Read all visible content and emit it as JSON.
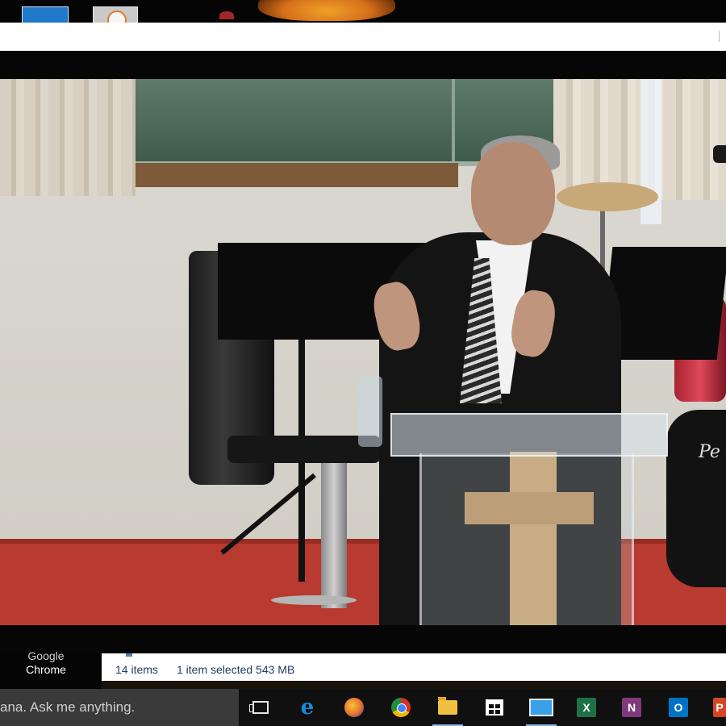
{
  "desktop": {
    "icons": [
      {
        "name": "desktop-shortcut"
      },
      {
        "name": "desktop-shortcut-dial"
      }
    ],
    "chrome_shortcut_label_line1": "Google",
    "chrome_shortcut_label_line2": "Chrome"
  },
  "video": {
    "podium_brand": "Pe"
  },
  "explorer": {
    "status_items": "14 items",
    "status_selected": "1 item selected  543 MB"
  },
  "taskbar": {
    "search_placeholder": "ana. Ask me anything.",
    "apps": [
      {
        "name": "task-view",
        "icon": "task-view-icon"
      },
      {
        "name": "edge",
        "icon": "edge-icon",
        "color": "#1a8ad8"
      },
      {
        "name": "firefox",
        "icon": "firefox-icon",
        "color": "#e8702a"
      },
      {
        "name": "chrome",
        "icon": "chrome-icon",
        "color": "#2fa84f"
      },
      {
        "name": "file-explorer",
        "icon": "folder-icon",
        "color": "#f0c040"
      },
      {
        "name": "store",
        "icon": "store-icon",
        "color": "#ffffff"
      },
      {
        "name": "remote-desktop",
        "icon": "monitor-icon",
        "color": "#3aa0e8"
      },
      {
        "name": "excel",
        "icon": "excel-icon",
        "color": "#1e7145",
        "letter": "X"
      },
      {
        "name": "onenote",
        "icon": "onenote-icon",
        "color": "#80397b",
        "letter": "N"
      },
      {
        "name": "outlook",
        "icon": "outlook-icon",
        "color": "#0072c6",
        "letter": "O"
      },
      {
        "name": "powerpoint",
        "icon": "powerpoint-icon",
        "color": "#d24726",
        "letter": "P"
      }
    ]
  }
}
